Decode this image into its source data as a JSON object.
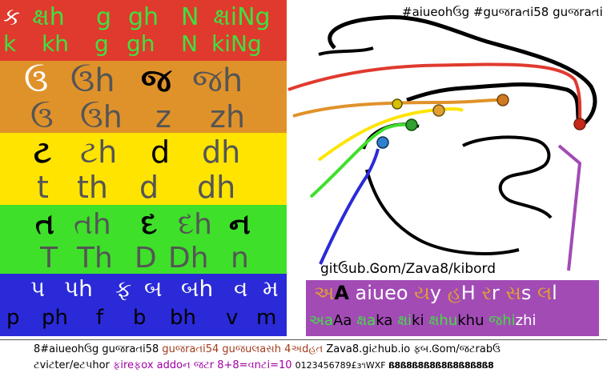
{
  "title": "#aiueohઉg #guજraતi58 guજraતi",
  "url": "gitઉub.Ꮆom/Zava8/kibord",
  "bands": {
    "red": {
      "top": [
        "ક",
        "ક્ષh",
        "g",
        "gh",
        "N",
        "ક્ષiNg"
      ],
      "bottom": [
        "k",
        "kh",
        "g",
        "gh",
        "N",
        "kiNg"
      ]
    },
    "orange": {
      "top": [
        "ઉ",
        "ઉh",
        "જ",
        "જh"
      ],
      "bottom": [
        "ઉ",
        "ઉh",
        "z",
        "zh"
      ]
    },
    "yellow": {
      "top": [
        "ટ",
        "ટh",
        "d",
        "dh"
      ],
      "bottom": [
        "t",
        "th",
        "d",
        "dh"
      ]
    },
    "green": {
      "top": [
        "ત",
        "તh",
        "દ",
        "દh",
        "ન"
      ],
      "bottom": [
        "T",
        "Th",
        "D",
        "Dh",
        "n"
      ]
    },
    "blue": {
      "top": [
        "પ",
        "પh",
        "ફ",
        "બ",
        "બh",
        "વ",
        "મ"
      ],
      "bottom": [
        "p",
        "ph",
        "f",
        "b",
        "bh",
        "v",
        "m"
      ]
    }
  },
  "vowels": {
    "line1": {
      "a1": "અ",
      "a2": "A",
      "aiueo": " aiueo ",
      "y1": "ય",
      "y2": "y ",
      "h1": "હ",
      "h2": "H ",
      "r1": "ર",
      "r2": "r ",
      "s1": "સ",
      "s2": "s ",
      "l1": "લ",
      "l2": "l"
    },
    "line2": [
      {
        "g": "અa",
        "l": "Aa"
      },
      {
        "g": "ક્ષa",
        "l": "ka"
      },
      {
        "g": "ક્ષi",
        "l": "ki"
      },
      {
        "g": "ક્ષhu",
        "l": "khu"
      },
      {
        "g": "જhi",
        "l": "zhi"
      }
    ]
  },
  "footer": {
    "line1": [
      {
        "text": "8#aiueohઉg guજraતi58 ",
        "color": "#000000"
      },
      {
        "text": "guજraતi54 guજuલaસh 4અdહત ",
        "color": "#a23a1a"
      },
      {
        "text": "Zava8.giટhub.io ફ્બ.Ꮆom/જટrabઉ",
        "color": "#000000"
      }
    ],
    "line2": [
      {
        "text": "ટviટter/eટ૫hor ",
        "color": "#000000"
      },
      {
        "text": "ફireફox addoન જટr ",
        "color": "#a000a0"
      },
      {
        "text": "8+8=વnટi=10 ",
        "color": "#a000a0"
      },
      {
        "text": "0123456789£ɜ૧WXF ",
        "color": "#000000"
      },
      {
        "text": "ß8ß8ß8ß8ß8ß8ß8ß8ß8",
        "color": "#000000"
      }
    ]
  },
  "colors": {
    "red": "#e03a2e",
    "orange": "#e0922a",
    "yellow": "#ffe400",
    "green": "#3ee02a",
    "blue": "#2a2ad8",
    "purple": "#a24bb5"
  }
}
